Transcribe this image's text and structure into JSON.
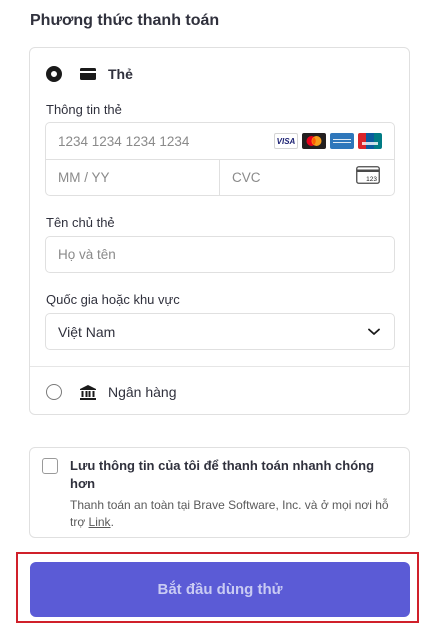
{
  "section_title": "Phương thức thanh toán",
  "methods": {
    "card": {
      "label": "Thẻ",
      "selected": true,
      "icon": "credit-card-icon"
    },
    "bank": {
      "label": "Ngân hàng",
      "selected": false,
      "icon": "bank-icon"
    }
  },
  "card_info": {
    "label": "Thông tin thẻ",
    "number_placeholder": "1234 1234 1234 1234",
    "expiry_placeholder": "MM / YY",
    "cvc_placeholder": "CVC",
    "cvc_icon_text": "123",
    "brands": [
      {
        "name": "visa",
        "text": "VISA"
      },
      {
        "name": "mastercard"
      },
      {
        "name": "amex"
      },
      {
        "name": "unionpay"
      }
    ]
  },
  "cardholder": {
    "label": "Tên chủ thẻ",
    "placeholder": "Họ và tên"
  },
  "country": {
    "label": "Quốc gia hoặc khu vực",
    "value": "Việt Nam"
  },
  "save_info": {
    "title": "Lưu thông tin của tôi để thanh toán nhanh chóng hơn",
    "description_prefix": "Thanh toán an toàn tại Brave Software, Inc. và ở mọi nơi hỗ trợ ",
    "link_text": "Link",
    "description_suffix": ".",
    "checked": false
  },
  "cta": {
    "label": "Bắt đầu dùng thử"
  },
  "colors": {
    "cta_background": "#5b5bd6",
    "cta_text": "#c9cbf3",
    "highlight_border": "#d0202a"
  }
}
